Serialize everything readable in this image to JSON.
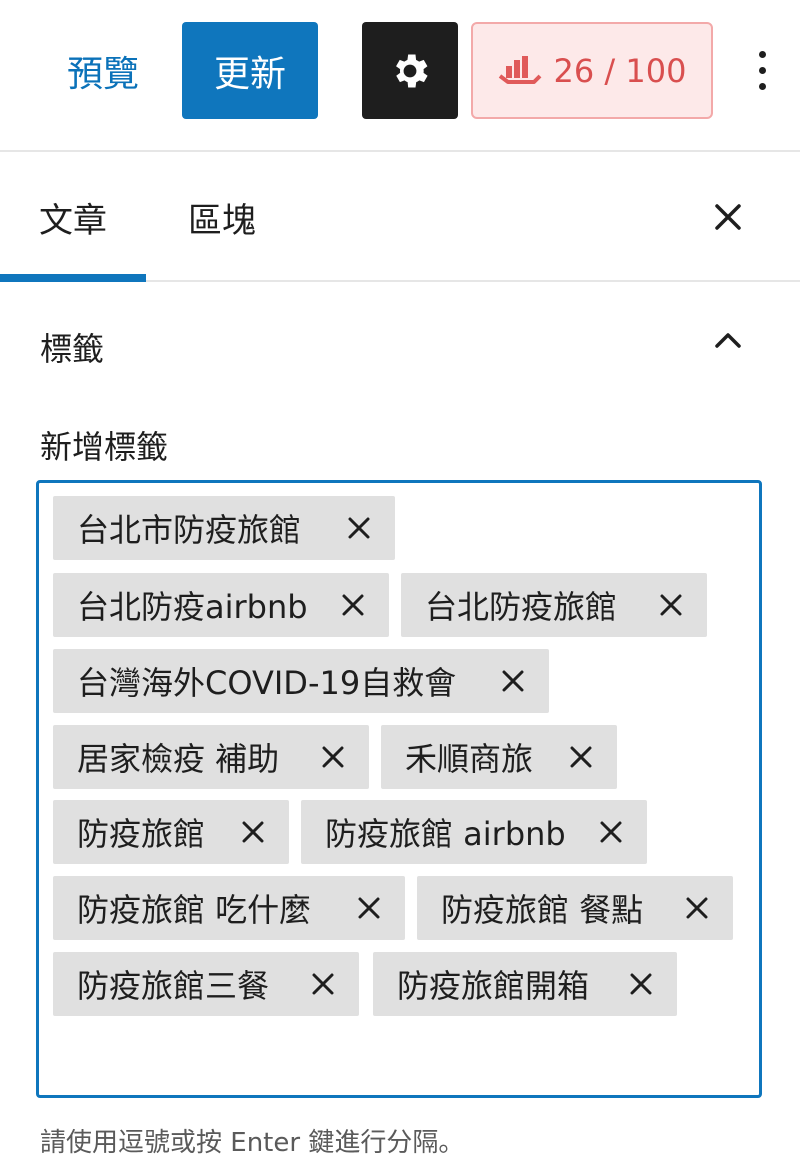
{
  "toolbar": {
    "preview_label": "預覽",
    "update_label": "更新",
    "settings_icon": "gear-icon",
    "seo_score": "26 / 100",
    "seo_icon": "chart-hand-icon",
    "more_icon": "vertical-ellipsis-icon"
  },
  "tabs": {
    "post_label": "文章",
    "block_label": "區塊",
    "active": "文章"
  },
  "panel": {
    "title": "標籤",
    "expanded": true,
    "add_label": "新增標籤",
    "tags": [
      "台北市防疫旅館",
      "台北防疫airbnb",
      "台北防疫旅館",
      "台灣海外COVID-19自救會",
      "居家檢疫 補助",
      "禾順商旅",
      "防疫旅館",
      "防疫旅館 airbnb",
      "防疫旅館 吃什麼",
      "防疫旅館 餐點",
      "防疫旅館三餐",
      "防疫旅館開箱"
    ],
    "help_text": "請使用逗號或按 Enter 鍵進行分隔。"
  },
  "colors": {
    "accent": "#0f76bd",
    "seo_bad_bg": "#fde9e9",
    "seo_bad_text": "#d94f4f",
    "token_bg": "#e0e0e0"
  }
}
